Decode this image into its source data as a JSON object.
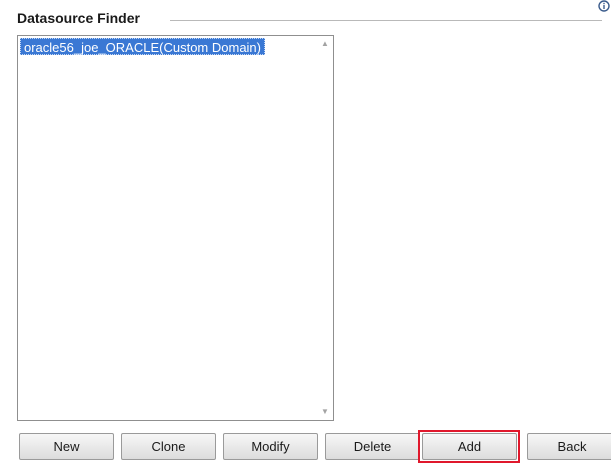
{
  "panel": {
    "title": "Datasource Finder",
    "help_icon": "help-icon"
  },
  "datasources": {
    "items": [
      {
        "label": "oracle56_joe_ORACLE(Custom Domain)",
        "selected": true
      }
    ]
  },
  "buttons": {
    "new": "New",
    "clone": "Clone",
    "modify": "Modify",
    "delete": "Delete",
    "add": "Add",
    "back": "Back"
  },
  "colors": {
    "selection": "#3a78d4",
    "highlight_frame": "#e0182c"
  }
}
